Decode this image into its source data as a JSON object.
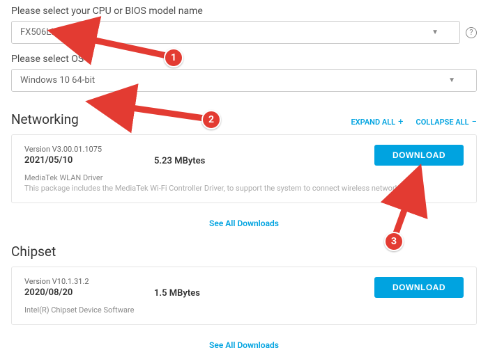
{
  "form": {
    "model_label": "Please select your CPU or BIOS model name",
    "model_value": "FX506LH",
    "os_label": "Please select OS",
    "os_value": "Windows 10 64-bit"
  },
  "actions": {
    "expand": "EXPAND ALL",
    "collapse": "COLLAPSE ALL"
  },
  "sections": [
    {
      "title": "Networking",
      "card": {
        "version": "Version V3.00.01.1075",
        "date": "2021/05/10",
        "size": "5.23 MBytes",
        "name": "MediaTek WLAN Driver",
        "desc": "This package includes the MediaTek Wi-Fi Controller Driver, to support the system to connect wireless network.",
        "download": "DOWNLOAD"
      },
      "see_all": "See All Downloads"
    },
    {
      "title": "Chipset",
      "card": {
        "version": "Version V10.1.31.2",
        "date": "2020/08/20",
        "size": "1.5 MBytes",
        "name": "Intel(R) Chipset Device Software",
        "desc": "",
        "download": "DOWNLOAD"
      },
      "see_all": "See All Downloads"
    }
  ],
  "annotations": {
    "b1": "1",
    "b2": "2",
    "b3": "3"
  }
}
